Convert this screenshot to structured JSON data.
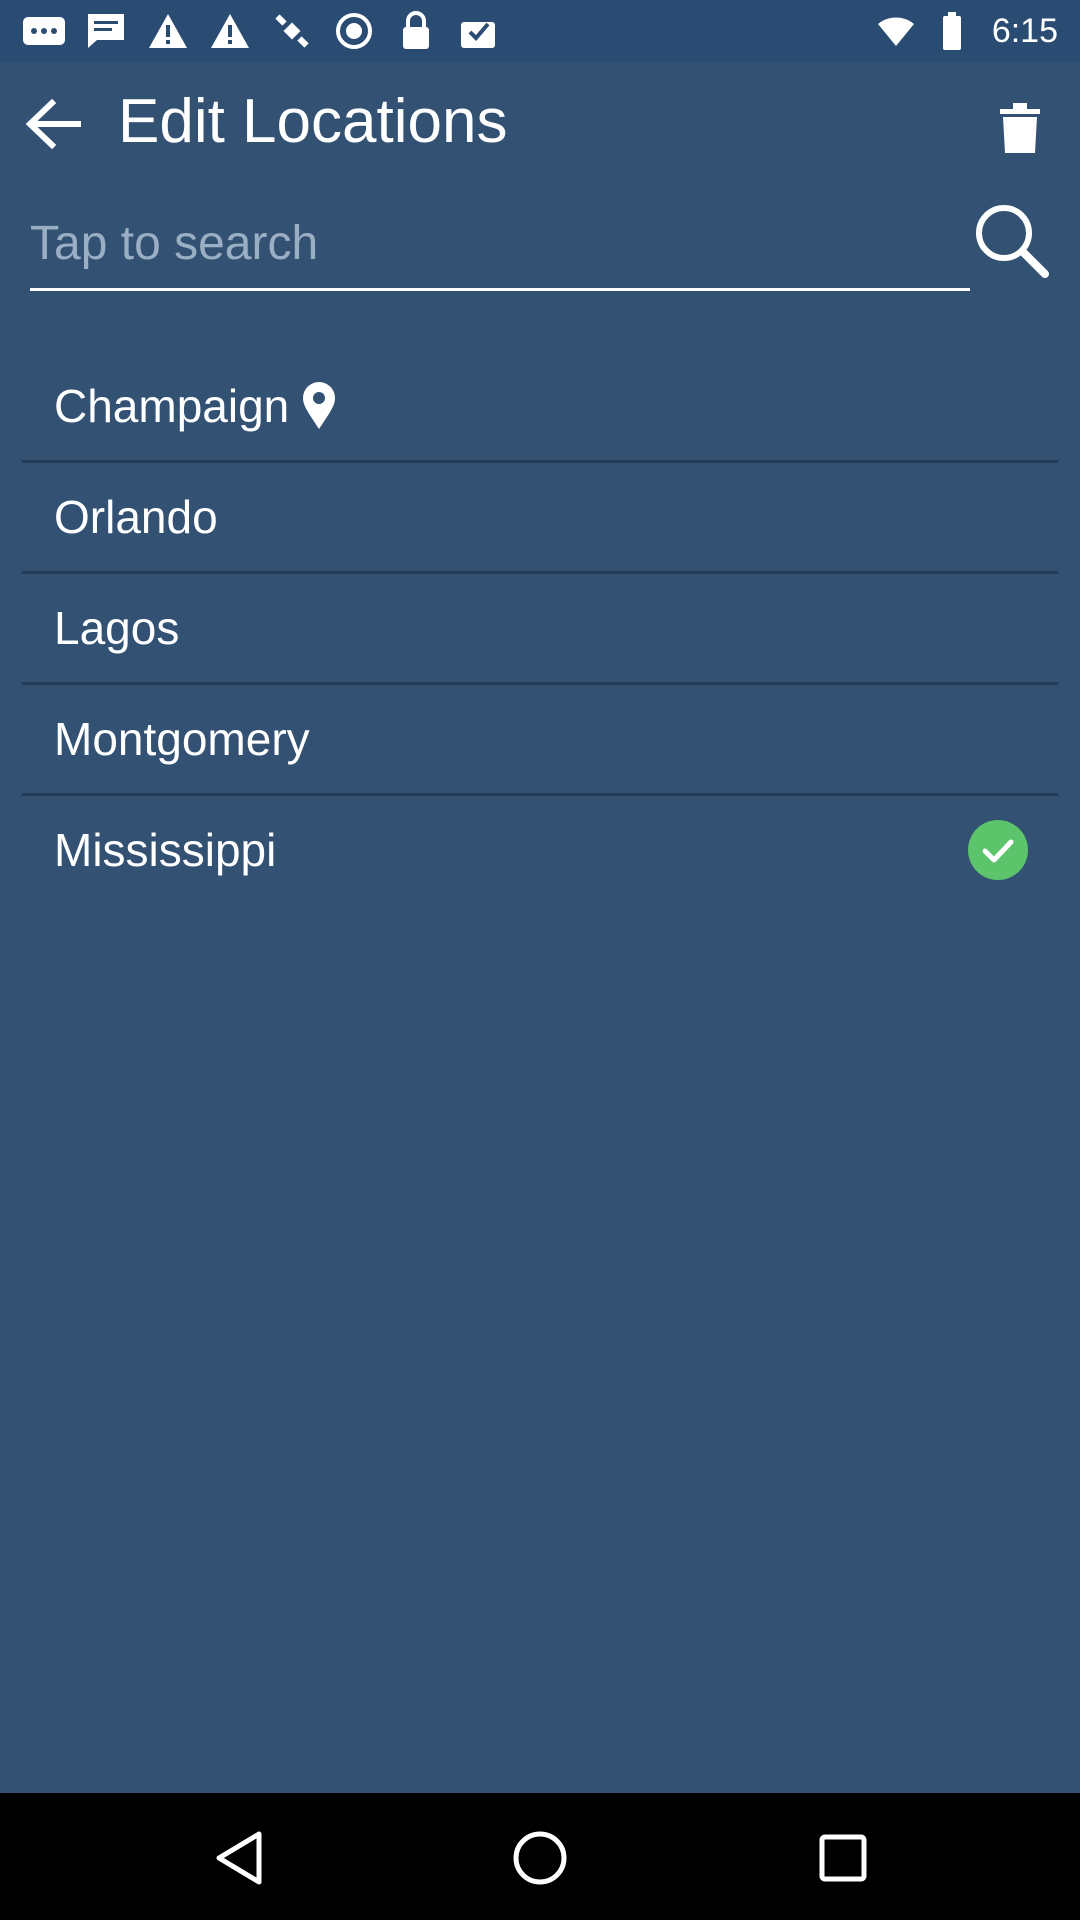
{
  "status_bar": {
    "time": "6:15",
    "icons": [
      "more-dots-icon",
      "message-icon",
      "warning-icon",
      "warning-icon",
      "satellite-icon",
      "record-icon",
      "lock-icon",
      "checkmark-box-icon",
      "wifi-icon",
      "battery-icon"
    ]
  },
  "toolbar": {
    "title": "Edit Locations",
    "back_icon": "arrow-back-icon",
    "delete_icon": "trash-icon"
  },
  "search": {
    "placeholder": "Tap to search",
    "value": "",
    "icon": "search-icon"
  },
  "locations": [
    {
      "name": "Champaign",
      "current_location": true,
      "selected": false
    },
    {
      "name": "Orlando",
      "current_location": false,
      "selected": false
    },
    {
      "name": "Lagos",
      "current_location": false,
      "selected": false
    },
    {
      "name": "Montgomery",
      "current_location": false,
      "selected": false
    },
    {
      "name": "Mississippi",
      "current_location": false,
      "selected": true
    }
  ],
  "colors": {
    "background": "#325173",
    "status_bar": "#2b4c72",
    "divider": "#213b59",
    "check": "#5cc46a",
    "text": "#ffffff"
  },
  "nav_bar": {
    "icons": [
      "back-triangle-icon",
      "home-circle-icon",
      "recents-square-icon"
    ]
  }
}
